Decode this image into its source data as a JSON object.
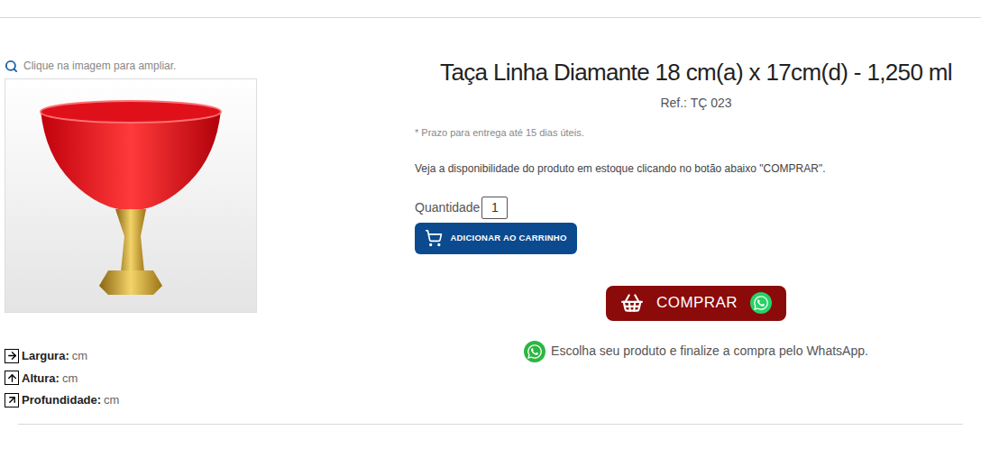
{
  "hint": "Clique na imagem para ampliar.",
  "product": {
    "title": "Taça Linha Diamante 18 cm(a) x 17cm(d) - 1,250 ml",
    "ref": "Ref.: TÇ 023",
    "delivery": "* Prazo para entrega até 15 dias úteis.",
    "availability": "Veja a disponibilidade do produto em estoque clicando no botão abaixo \"COMPRAR\"."
  },
  "quantity": {
    "label": "Quantidade",
    "value": "1"
  },
  "buttons": {
    "add_to_cart": "ADICIONAR AO CARRINHO",
    "buy": "COMPRAR"
  },
  "whatsapp_note": "Escolha seu produto e finalize a compra pelo WhatsApp.",
  "dimensions": [
    {
      "kind": "width",
      "label": "Largura:",
      "unit": "cm"
    },
    {
      "kind": "height",
      "label": "Altura:",
      "unit": "cm"
    },
    {
      "kind": "depth",
      "label": "Profundidade:",
      "unit": "cm"
    }
  ]
}
